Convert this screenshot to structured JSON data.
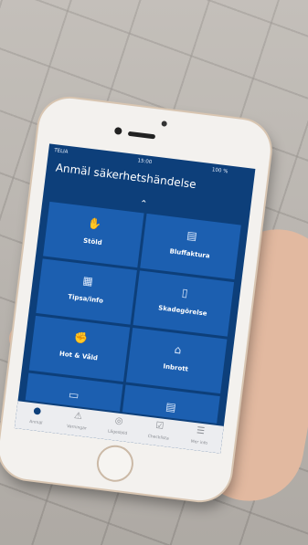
{
  "status": {
    "carrier": "TELIA",
    "time": "15:00",
    "battery": "100 %"
  },
  "screen_title": "Anmäl säkerhetshändelse",
  "collapse_icon": "chevron-up-icon",
  "tiles": [
    {
      "label": "Stöld",
      "icon": "theft-icon"
    },
    {
      "label": "Bluffaktura",
      "icon": "invoice-icon"
    },
    {
      "label": "Tipsa/info",
      "icon": "info-board-icon"
    },
    {
      "label": "Skadegörelse",
      "icon": "spray-can-icon"
    },
    {
      "label": "Hot & Våld",
      "icon": "threat-icon"
    },
    {
      "label": "Inbrott",
      "icon": "break-in-icon"
    },
    {
      "label": "",
      "icon": "card-icon"
    },
    {
      "label": "",
      "icon": "document-icon"
    }
  ],
  "tabs": [
    {
      "label": "Anmäl",
      "icon": "report-icon"
    },
    {
      "label": "Varningar",
      "icon": "warning-icon"
    },
    {
      "label": "Lägesbild",
      "icon": "map-icon"
    },
    {
      "label": "Checklista",
      "icon": "checklist-icon"
    },
    {
      "label": "Mer info",
      "icon": "more-info-icon"
    }
  ],
  "colors": {
    "screen_bg": "#0d3f7a",
    "tile_bg": "#1c5fb0",
    "tabbar_bg": "#ecedf0"
  }
}
